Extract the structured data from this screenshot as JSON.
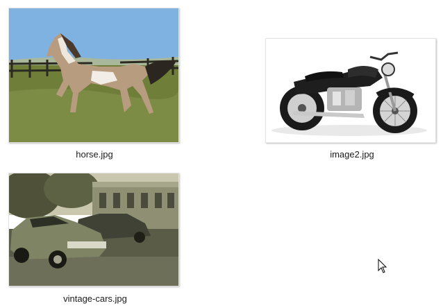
{
  "files": [
    {
      "name": "horse.jpg",
      "icon": "horse-photo-thumbnail"
    },
    {
      "name": "image2.jpg",
      "icon": "motorcycle-photo-thumbnail"
    },
    {
      "name": "vintage-cars.jpg",
      "icon": "vintage-cars-photo-thumbnail"
    }
  ],
  "colors": {
    "background": "#ffffff",
    "label_text": "#1b1b1b"
  }
}
